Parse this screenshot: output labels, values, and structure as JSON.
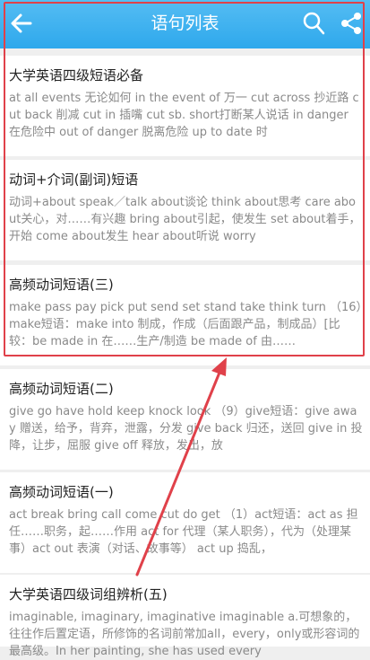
{
  "header": {
    "title": "语句列表",
    "accent_color": "#2ea8ec",
    "icons": [
      "back-arrow-icon",
      "search-icon",
      "share-icon"
    ]
  },
  "items": [
    {
      "title": "大学英语四级短语必备",
      "text": "at all events 无论如何 in the event of 万一 cut across 抄近路 cut back 削减 cut in 插嘴 cut sb. short打断某人说话 in danger 在危险中 out of danger 脱离危险 up to date 时"
    },
    {
      "title": "动词+介词(副词)短语",
      "text": "动词+about speak／talk about谈论 think about思考 care about关心，对……有兴趣 bring about引起，使发生 set about着手，开始 come about发生 hear about听说 worry"
    },
    {
      "title": "高频动词短语(三)",
      "text": "make pass pay pick put send set stand take think turn （16）make短语：make into 制成，作成（后面跟产品，制成品）[比较：be made in 在……生产/制造 be made of 由……"
    },
    {
      "title": "高频动词短语(二)",
      "text": "give go have hold keep knock look （9）give短语：give away 赠送，给予，背弃，泄露，分发 give back 归还，送回 give in 投降，让步，屈服 give off 释放，发出，放"
    },
    {
      "title": "高频动词短语(一)",
      "text": "act break bring call come cut do get （1）act短语：act as 担任……职务，起……作用 act for 代理（某人职务），代为（处理某事）act out 表演（对话、故事等） act up 捣乱，"
    },
    {
      "title": "大学英语四级词组辨析(五)",
      "text": "imaginable, imaginary, imaginative imaginable a.可想象的，往往作后置定语，所修饰的名词前常加all，every，only或形容词的最高级。In her painting, she has used every"
    }
  ],
  "annotation": {
    "color": "#e0414a"
  }
}
